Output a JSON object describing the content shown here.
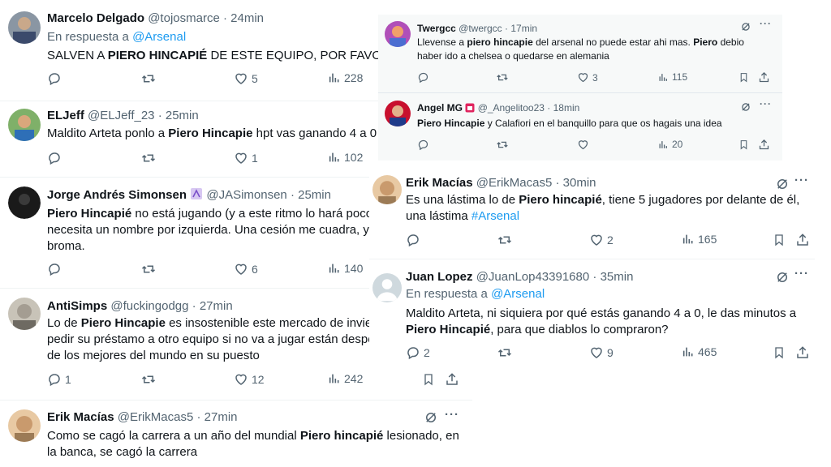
{
  "tweets": {
    "t1": {
      "name": "Marcelo Delgado",
      "handle": "@tojosmarce",
      "time": "24min",
      "reply_prefix": "En respuesta a",
      "reply_to": "@Arsenal",
      "text_1": "SALVEN A ",
      "text_bold": "PIERO HINCAPIÉ",
      "text_2": " DE ESTE EQUIPO, POR FAVOR.",
      "likes": "5",
      "views": "228"
    },
    "t2": {
      "name": "ELJeff",
      "handle": "@ELJeff_23",
      "time": "25min",
      "text_1": "Maldito Arteta ponlo a ",
      "text_bold": "Piero Hincapie",
      "text_2": " hpt vas ganando 4 a 0",
      "likes": "1",
      "views": "102"
    },
    "t3": {
      "name": "Jorge Andrés Simonsen",
      "handle": "@JASimonsen",
      "time": "25min",
      "line1_bold": "Piero Hincapié",
      "line1_rest": " no está jugando (y a este ritmo lo hará poco",
      "line2": "necesita un nombre por izquierda. Una cesión me cuadra, y",
      "line3": "broma.",
      "likes": "6",
      "views": "140"
    },
    "t4": {
      "name": "AntiSimps",
      "handle": "@fuckingodgg",
      "time": "27min",
      "line1_pre": "Lo de ",
      "line1_bold": "Piero Hincapie",
      "line1_rest": " es insostenible este mercado de invie",
      "line2": "pedir su préstamo a otro equipo si no va a jugar están despe",
      "line3": "de los mejores del mundo en su puesto",
      "replies": "1",
      "likes": "12",
      "views": "242"
    },
    "t5": {
      "name": "Erik Macías",
      "handle": "@ErikMacas5",
      "time": "27min",
      "line1_pre": "Como se cagó la carrera a un año del mundial ",
      "line1_bold": "Piero hincapié",
      "line1_rest": " lesionado, en",
      "line2": "la banca, se cagó la carrera"
    },
    "t6": {
      "name": "Twergcc",
      "handle": "@twergcc",
      "time": "17min",
      "line1_pre": "Llevense a ",
      "line1_bold": "piero hincapie",
      "line1_rest": " del arsenal no puede estar ahi mas. ",
      "line1_bold2": "Piero",
      "line1_end": " debio",
      "line2": "haber ido a chelsea o quedarse en alemania",
      "likes": "3",
      "views": "115"
    },
    "t7": {
      "name": "Angel MG",
      "handle": "@_Angelitoo23",
      "time": "18min",
      "line1_bold": "Piero Hincapie",
      "line1_rest": " y Calafiori en el banquillo para que os hagais una idea",
      "views": "20"
    },
    "t8": {
      "name": "Erik Macías",
      "handle": "@ErikMacas5",
      "time": "30min",
      "line1_pre": "Es una lástima lo de ",
      "line1_bold": "Piero hincapié",
      "line1_rest": ", tiene 5 jugadores por delante de él,",
      "line2_pre": "una lástima ",
      "line2_tag": "#Arsenal",
      "likes": "2",
      "views": "165"
    },
    "t9": {
      "name": "Juan Lopez",
      "handle": "@JuanLop43391680",
      "time": "35min",
      "reply_prefix": "En respuesta a",
      "reply_to": "@Arsenal",
      "line1": "Maldito Arteta, ni siquiera por qué estás ganando 4 a 0, le das minutos a",
      "line2_bold": "Piero Hincapié",
      "line2_rest": ", para que diablos lo compraron?",
      "replies": "2",
      "likes": "9",
      "views": "465"
    }
  },
  "separator": " · ",
  "colors": {
    "accent": "#1d9bf0",
    "muted": "#536471",
    "text": "#0f1419"
  },
  "icons": [
    "reply-icon",
    "retweet-icon",
    "like-icon",
    "views-icon",
    "bookmark-icon",
    "share-icon",
    "grok-icon",
    "more-icon"
  ]
}
